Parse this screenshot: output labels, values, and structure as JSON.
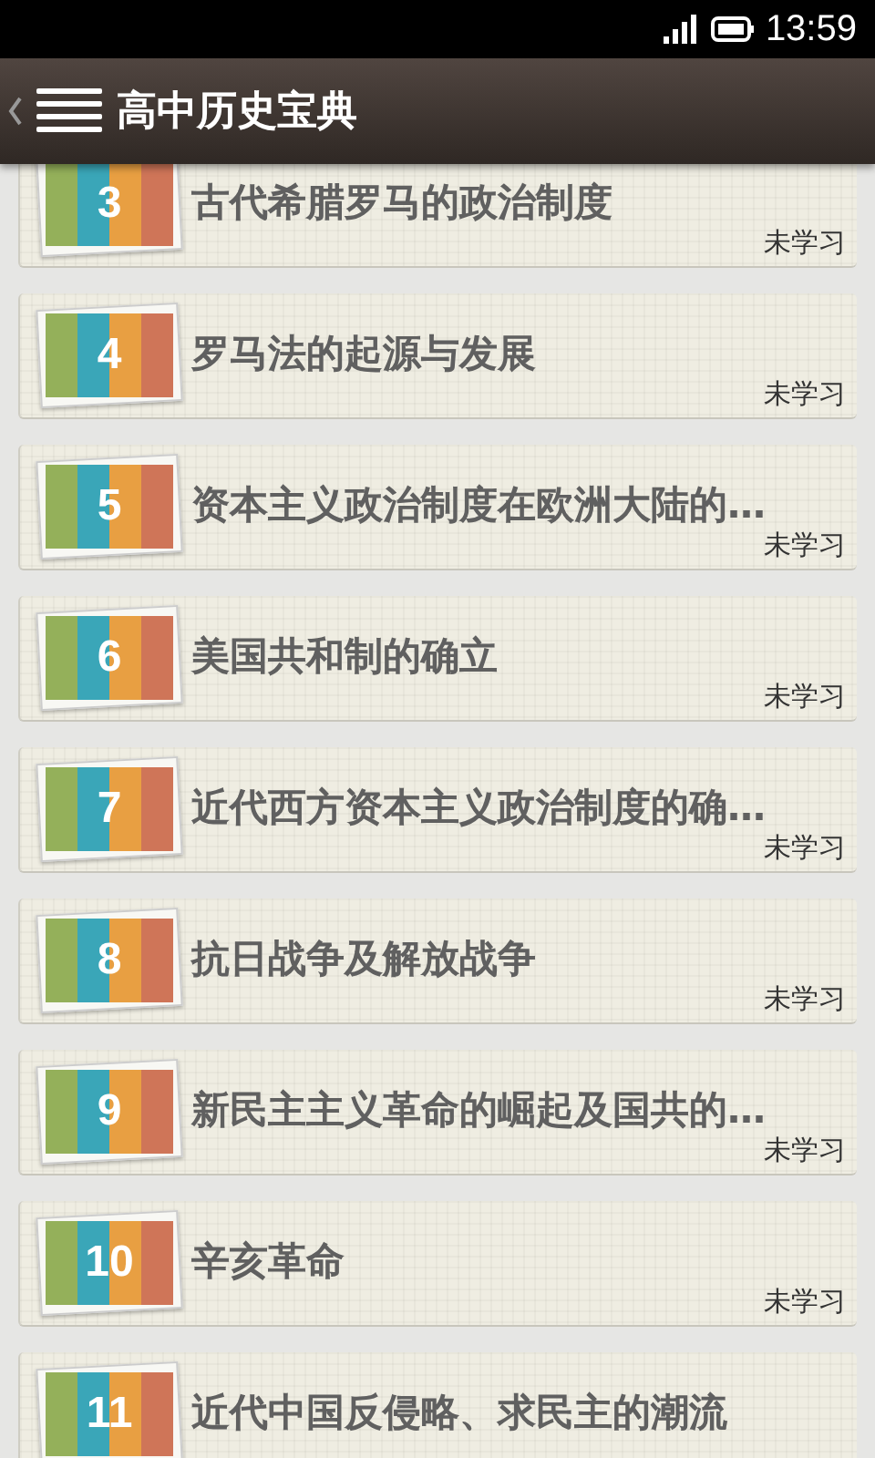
{
  "status_bar": {
    "time": "13:59"
  },
  "app_bar": {
    "title": "高中历史宝典"
  },
  "lessons": [
    {
      "number": "3",
      "title": "古代希腊罗马的政治制度",
      "status": "未学习"
    },
    {
      "number": "4",
      "title": "罗马法的起源与发展",
      "status": "未学习"
    },
    {
      "number": "5",
      "title": "资本主义政治制度在欧洲大陆的…",
      "status": "未学习"
    },
    {
      "number": "6",
      "title": "美国共和制的确立",
      "status": "未学习"
    },
    {
      "number": "7",
      "title": "近代西方资本主义政治制度的确…",
      "status": "未学习"
    },
    {
      "number": "8",
      "title": "抗日战争及解放战争",
      "status": "未学习"
    },
    {
      "number": "9",
      "title": "新民主主义革命的崛起及国共的…",
      "status": "未学习"
    },
    {
      "number": "10",
      "title": "辛亥革命",
      "status": "未学习"
    },
    {
      "number": "11",
      "title": "近代中国反侵略、求民主的潮流"
    }
  ]
}
